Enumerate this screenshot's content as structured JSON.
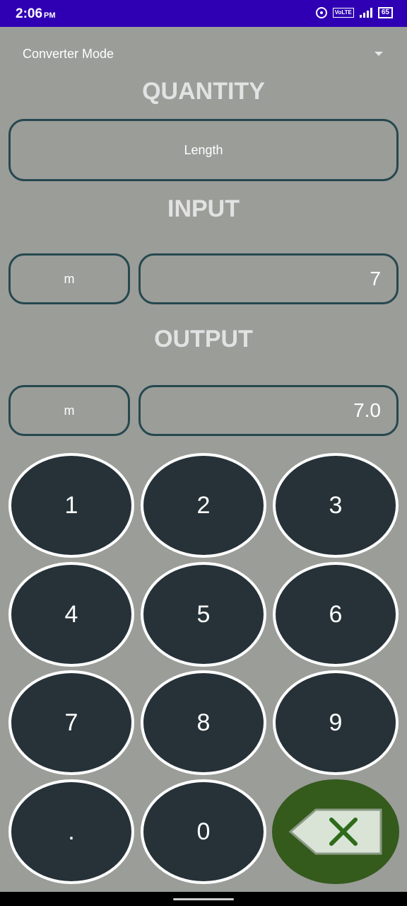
{
  "status_bar": {
    "time": "2:06",
    "ampm": "PM",
    "volte": "VoLTE",
    "battery": "65"
  },
  "mode_selector": {
    "label": "Converter Mode"
  },
  "sections": {
    "quantity": "QUANTITY",
    "input": "INPUT",
    "output": "OUTPUT"
  },
  "quantity_field": {
    "value": "Length"
  },
  "input": {
    "unit": "m",
    "value": "7"
  },
  "output": {
    "unit": "m",
    "value": "7.0"
  },
  "keypad": {
    "keys": [
      "1",
      "2",
      "3",
      "4",
      "5",
      "6",
      "7",
      "8",
      "9",
      ".",
      "0"
    ]
  },
  "colors": {
    "background": "#9b9d99",
    "status_bar": "#2f00b3",
    "key_fill": "#263238",
    "field_border": "#26484f",
    "backspace_fill": "#345a1c"
  }
}
